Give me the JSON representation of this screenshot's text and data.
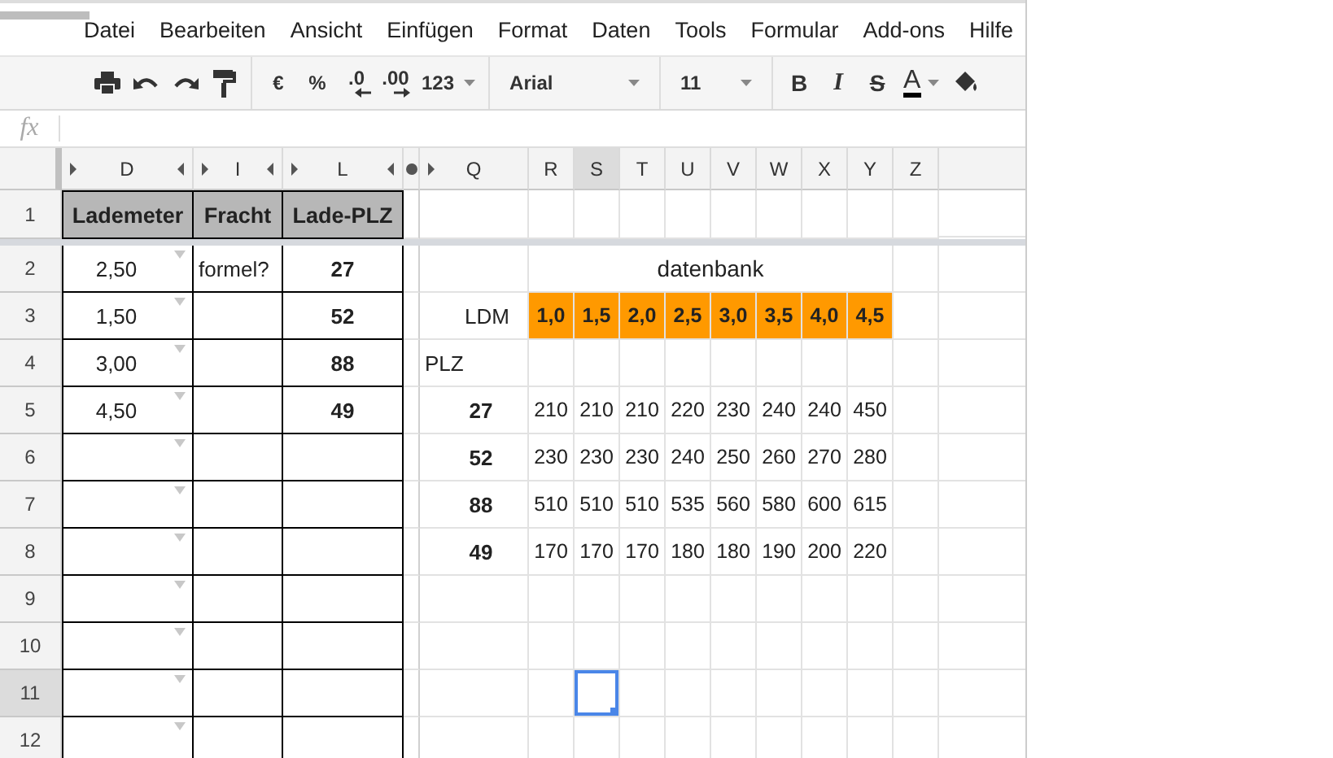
{
  "menu": {
    "items": [
      "Datei",
      "Bearbeiten",
      "Ansicht",
      "Einfügen",
      "Format",
      "Daten",
      "Tools",
      "Formular",
      "Add-ons",
      "Hilfe"
    ]
  },
  "toolbar": {
    "groups": [
      [
        {
          "kind": "print"
        },
        {
          "kind": "undo"
        },
        {
          "kind": "redo"
        },
        {
          "kind": "paint"
        }
      ],
      [
        {
          "kind": "text",
          "text": "€"
        },
        {
          "kind": "text",
          "text": "%"
        },
        {
          "kind": "decimal-less",
          "text": ".0"
        },
        {
          "kind": "decimal-more",
          "text": ".00"
        },
        {
          "kind": "dropdown",
          "text": "123"
        }
      ],
      [
        {
          "kind": "font",
          "text": "Arial"
        }
      ],
      [
        {
          "kind": "size",
          "text": "11"
        }
      ],
      [
        {
          "kind": "bold",
          "text": "B"
        },
        {
          "kind": "italic",
          "text": "I"
        },
        {
          "kind": "strike",
          "text": "S"
        },
        {
          "kind": "color",
          "text": "A"
        },
        {
          "kind": "fill"
        }
      ]
    ]
  },
  "formula_bar": {
    "label": "fx"
  },
  "sheet": {
    "columns": [
      {
        "label": "D",
        "kind": "framed",
        "hidden_left": true,
        "hidden_right": true,
        "selected": false
      },
      {
        "label": "I",
        "kind": "framed",
        "hidden_left": true,
        "hidden_right": true,
        "selected": false
      },
      {
        "label": "L",
        "kind": "framed",
        "hidden_left": true,
        "hidden_right": true,
        "selected": false
      },
      {
        "kind": "gap",
        "selected": false
      },
      {
        "label": "Q",
        "kind": "plain",
        "hidden_left": true,
        "hidden_right": false,
        "selected": false
      },
      {
        "label": "R",
        "kind": "plain",
        "hidden_left": false,
        "hidden_right": false,
        "selected": false
      },
      {
        "label": "S",
        "kind": "plain",
        "hidden_left": false,
        "hidden_right": false,
        "selected": true
      },
      {
        "label": "T",
        "kind": "plain",
        "hidden_left": false,
        "hidden_right": false,
        "selected": false
      },
      {
        "label": "U",
        "kind": "plain",
        "hidden_left": false,
        "hidden_right": false,
        "selected": false
      },
      {
        "label": "V",
        "kind": "plain",
        "hidden_left": false,
        "hidden_right": false,
        "selected": false
      },
      {
        "label": "W",
        "kind": "plain",
        "hidden_left": false,
        "hidden_right": false,
        "selected": false
      },
      {
        "label": "X",
        "kind": "plain",
        "hidden_left": false,
        "hidden_right": false,
        "selected": false
      },
      {
        "label": "Y",
        "kind": "plain",
        "hidden_left": false,
        "hidden_right": false,
        "selected": false
      },
      {
        "label": "Z",
        "kind": "plain",
        "hidden_left": false,
        "hidden_right": false,
        "selected": false
      }
    ],
    "rows": [
      {
        "label": "1",
        "selected": false,
        "frozen": true,
        "cells": [
          {
            "kind": "head",
            "text": "Lademeter"
          },
          {
            "kind": "head",
            "text": "Fracht"
          },
          {
            "kind": "head",
            "text": "Lade-PLZ"
          },
          {
            "kind": "gap"
          },
          {
            "kind": "blank"
          },
          {
            "kind": "blank"
          },
          {
            "kind": "blank"
          },
          {
            "kind": "blank"
          },
          {
            "kind": "blank"
          },
          {
            "kind": "blank"
          },
          {
            "kind": "blank"
          },
          {
            "kind": "blank"
          },
          {
            "kind": "blank"
          },
          {
            "kind": "blank"
          }
        ]
      },
      {
        "label": "2",
        "selected": false,
        "frozen": false,
        "cells": [
          {
            "kind": "choice",
            "text": "2,50"
          },
          {
            "kind": "note",
            "text": "formel?"
          },
          {
            "kind": "key",
            "text": "27"
          },
          {
            "kind": "gap"
          },
          {
            "kind": "blank"
          },
          {
            "kind": "merged"
          },
          {
            "kind": "merged"
          },
          {
            "kind": "merged"
          },
          {
            "kind": "banner",
            "text": "datenbank"
          },
          {
            "kind": "merged"
          },
          {
            "kind": "merged"
          },
          {
            "kind": "merged"
          },
          {
            "kind": "merged"
          },
          {
            "kind": "blank"
          }
        ]
      },
      {
        "label": "3",
        "selected": false,
        "frozen": false,
        "cells": [
          {
            "kind": "choice",
            "text": "1,50"
          },
          {
            "kind": "box"
          },
          {
            "kind": "key",
            "text": "52"
          },
          {
            "kind": "gap"
          },
          {
            "kind": "label-right",
            "text": "LDM"
          },
          {
            "kind": "orange",
            "text": "1,0"
          },
          {
            "kind": "orange",
            "text": "1,5"
          },
          {
            "kind": "orange",
            "text": "2,0"
          },
          {
            "kind": "orange",
            "text": "2,5"
          },
          {
            "kind": "orange",
            "text": "3,0"
          },
          {
            "kind": "orange",
            "text": "3,5"
          },
          {
            "kind": "orange",
            "text": "4,0"
          },
          {
            "kind": "orange",
            "text": "4,5"
          },
          {
            "kind": "blank"
          }
        ]
      },
      {
        "label": "4",
        "selected": false,
        "frozen": false,
        "cells": [
          {
            "kind": "choice",
            "text": "3,00"
          },
          {
            "kind": "box"
          },
          {
            "kind": "key",
            "text": "88"
          },
          {
            "kind": "gap"
          },
          {
            "kind": "label-left",
            "text": "PLZ"
          },
          {
            "kind": "blank"
          },
          {
            "kind": "blank"
          },
          {
            "kind": "blank"
          },
          {
            "kind": "blank"
          },
          {
            "kind": "blank"
          },
          {
            "kind": "blank"
          },
          {
            "kind": "blank"
          },
          {
            "kind": "blank"
          },
          {
            "kind": "blank"
          }
        ]
      },
      {
        "label": "5",
        "selected": false,
        "frozen": false,
        "cells": [
          {
            "kind": "choice",
            "text": "4,50"
          },
          {
            "kind": "box"
          },
          {
            "kind": "key",
            "text": "49"
          },
          {
            "kind": "gap"
          },
          {
            "kind": "rowkey",
            "text": "27"
          },
          {
            "kind": "value",
            "text": "210"
          },
          {
            "kind": "value",
            "text": "210"
          },
          {
            "kind": "value",
            "text": "210"
          },
          {
            "kind": "value",
            "text": "220"
          },
          {
            "kind": "value",
            "text": "230"
          },
          {
            "kind": "value",
            "text": "240"
          },
          {
            "kind": "value",
            "text": "240"
          },
          {
            "kind": "value",
            "text": "450"
          },
          {
            "kind": "blank"
          }
        ]
      },
      {
        "label": "6",
        "selected": false,
        "frozen": false,
        "cells": [
          {
            "kind": "choice"
          },
          {
            "kind": "box"
          },
          {
            "kind": "box"
          },
          {
            "kind": "gap"
          },
          {
            "kind": "rowkey",
            "text": "52"
          },
          {
            "kind": "value",
            "text": "230"
          },
          {
            "kind": "value",
            "text": "230"
          },
          {
            "kind": "value",
            "text": "230"
          },
          {
            "kind": "value",
            "text": "240"
          },
          {
            "kind": "value",
            "text": "250"
          },
          {
            "kind": "value",
            "text": "260"
          },
          {
            "kind": "value",
            "text": "270"
          },
          {
            "kind": "value",
            "text": "280"
          },
          {
            "kind": "blank"
          }
        ]
      },
      {
        "label": "7",
        "selected": false,
        "frozen": false,
        "cells": [
          {
            "kind": "choice"
          },
          {
            "kind": "box"
          },
          {
            "kind": "box"
          },
          {
            "kind": "gap"
          },
          {
            "kind": "rowkey",
            "text": "88"
          },
          {
            "kind": "value",
            "text": "510"
          },
          {
            "kind": "value",
            "text": "510"
          },
          {
            "kind": "value",
            "text": "510"
          },
          {
            "kind": "value",
            "text": "535"
          },
          {
            "kind": "value",
            "text": "560"
          },
          {
            "kind": "value",
            "text": "580"
          },
          {
            "kind": "value",
            "text": "600"
          },
          {
            "kind": "value",
            "text": "615"
          },
          {
            "kind": "blank"
          }
        ]
      },
      {
        "label": "8",
        "selected": false,
        "frozen": false,
        "cells": [
          {
            "kind": "choice"
          },
          {
            "kind": "box"
          },
          {
            "kind": "box"
          },
          {
            "kind": "gap"
          },
          {
            "kind": "rowkey",
            "text": "49"
          },
          {
            "kind": "value",
            "text": "170"
          },
          {
            "kind": "value",
            "text": "170"
          },
          {
            "kind": "value",
            "text": "170"
          },
          {
            "kind": "value",
            "text": "180"
          },
          {
            "kind": "value",
            "text": "180"
          },
          {
            "kind": "value",
            "text": "190"
          },
          {
            "kind": "value",
            "text": "200"
          },
          {
            "kind": "value",
            "text": "220"
          },
          {
            "kind": "blank"
          }
        ]
      },
      {
        "label": "9",
        "selected": false,
        "frozen": false,
        "cells": [
          {
            "kind": "choice"
          },
          {
            "kind": "box"
          },
          {
            "kind": "box"
          },
          {
            "kind": "gap"
          },
          {
            "kind": "blank"
          },
          {
            "kind": "blank"
          },
          {
            "kind": "blank"
          },
          {
            "kind": "blank"
          },
          {
            "kind": "blank"
          },
          {
            "kind": "blank"
          },
          {
            "kind": "blank"
          },
          {
            "kind": "blank"
          },
          {
            "kind": "blank"
          },
          {
            "kind": "blank"
          }
        ]
      },
      {
        "label": "10",
        "selected": false,
        "frozen": false,
        "cells": [
          {
            "kind": "choice"
          },
          {
            "kind": "box"
          },
          {
            "kind": "box"
          },
          {
            "kind": "gap"
          },
          {
            "kind": "blank"
          },
          {
            "kind": "blank"
          },
          {
            "kind": "blank"
          },
          {
            "kind": "blank"
          },
          {
            "kind": "blank"
          },
          {
            "kind": "blank"
          },
          {
            "kind": "blank"
          },
          {
            "kind": "blank"
          },
          {
            "kind": "blank"
          },
          {
            "kind": "blank"
          }
        ]
      },
      {
        "label": "11",
        "selected": true,
        "frozen": false,
        "cells": [
          {
            "kind": "choice"
          },
          {
            "kind": "box"
          },
          {
            "kind": "box"
          },
          {
            "kind": "gap"
          },
          {
            "kind": "blank"
          },
          {
            "kind": "blank"
          },
          {
            "kind": "blank"
          },
          {
            "kind": "blank"
          },
          {
            "kind": "blank"
          },
          {
            "kind": "blank"
          },
          {
            "kind": "blank"
          },
          {
            "kind": "blank"
          },
          {
            "kind": "blank"
          },
          {
            "kind": "blank"
          }
        ]
      },
      {
        "label": "12",
        "selected": false,
        "frozen": false,
        "cells": [
          {
            "kind": "choice"
          },
          {
            "kind": "box"
          },
          {
            "kind": "box"
          },
          {
            "kind": "gap"
          },
          {
            "kind": "blank"
          },
          {
            "kind": "blank"
          },
          {
            "kind": "blank"
          },
          {
            "kind": "blank"
          },
          {
            "kind": "blank"
          },
          {
            "kind": "blank"
          },
          {
            "kind": "blank"
          },
          {
            "kind": "blank"
          },
          {
            "kind": "blank"
          },
          {
            "kind": "blank"
          }
        ]
      }
    ]
  }
}
